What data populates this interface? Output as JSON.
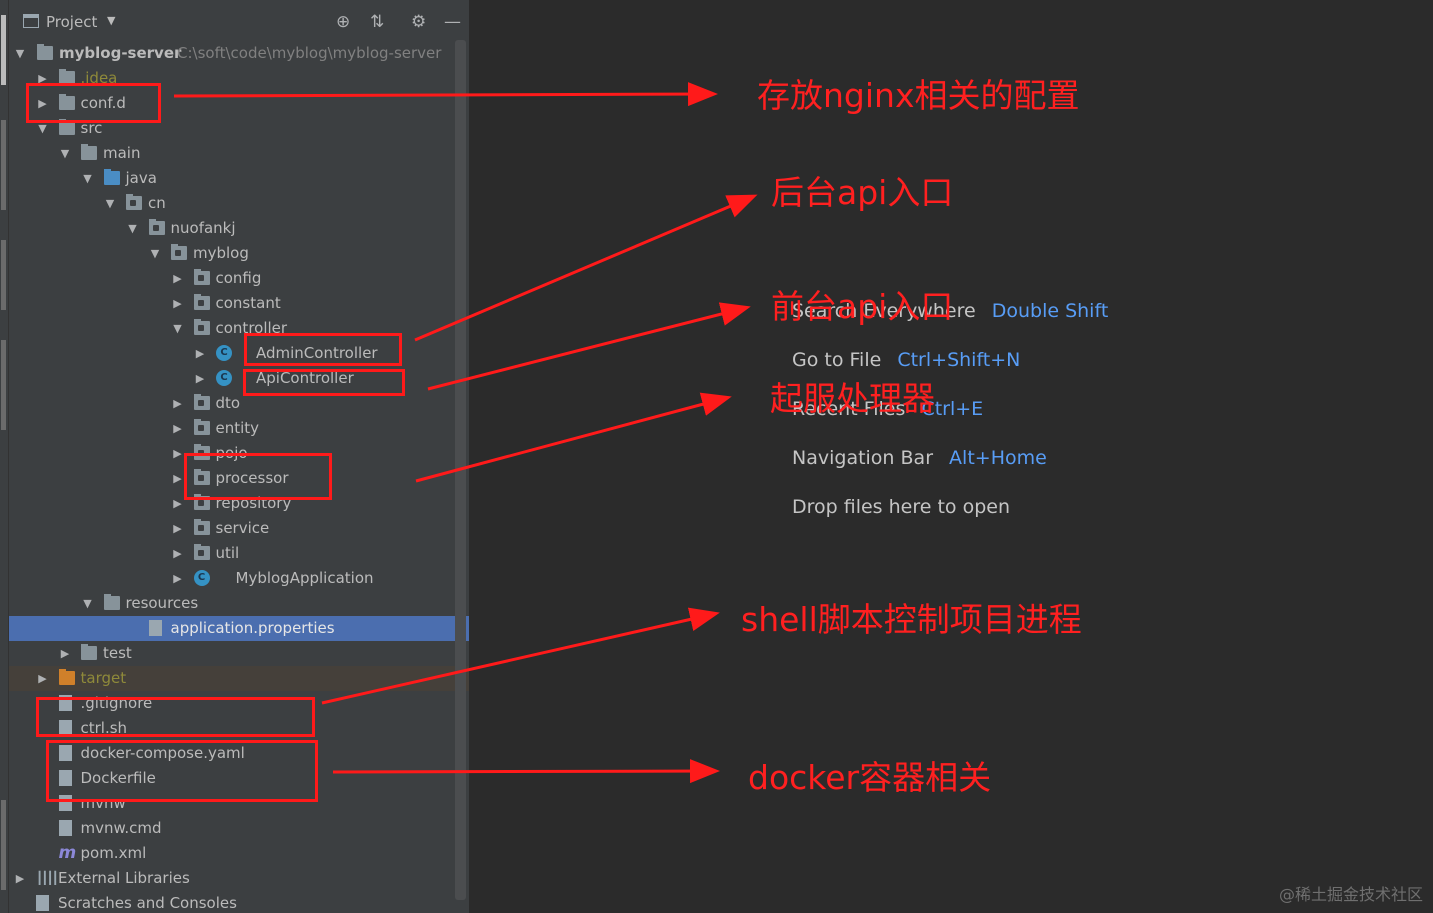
{
  "panel": {
    "title": "Project"
  },
  "root": {
    "name": "myblog-server",
    "path": "C:\\soft\\code\\myblog\\myblog-server"
  },
  "tree": [
    {
      "id": "idea",
      "label": ".idea",
      "style": "olive"
    },
    {
      "id": "confd",
      "label": "conf.d"
    },
    {
      "id": "src",
      "label": "src"
    },
    {
      "id": "main",
      "label": "main"
    },
    {
      "id": "java",
      "label": "java"
    },
    {
      "id": "cn",
      "label": "cn"
    },
    {
      "id": "nuofankj",
      "label": "nuofankj"
    },
    {
      "id": "myblog",
      "label": "myblog"
    },
    {
      "id": "config",
      "label": "config"
    },
    {
      "id": "constant",
      "label": "constant"
    },
    {
      "id": "controller",
      "label": "controller"
    },
    {
      "id": "admincontroller",
      "label": "AdminController"
    },
    {
      "id": "apicontroller",
      "label": "ApiController"
    },
    {
      "id": "dto",
      "label": "dto"
    },
    {
      "id": "entity",
      "label": "entity"
    },
    {
      "id": "pojo",
      "label": "pojo"
    },
    {
      "id": "processor",
      "label": "processor"
    },
    {
      "id": "repository",
      "label": "repository"
    },
    {
      "id": "service",
      "label": "service"
    },
    {
      "id": "util",
      "label": "util"
    },
    {
      "id": "myblogapplication",
      "label": "MyblogApplication"
    },
    {
      "id": "resources",
      "label": "resources"
    },
    {
      "id": "appprops",
      "label": "application.properties",
      "selected": true
    },
    {
      "id": "test",
      "label": "test"
    },
    {
      "id": "target",
      "label": "target",
      "style": "olive"
    },
    {
      "id": "gitignore",
      "label": ".gitignore"
    },
    {
      "id": "ctrlsh",
      "label": "ctrl.sh"
    },
    {
      "id": "dockercompose",
      "label": "docker-compose.yaml"
    },
    {
      "id": "dockerfile",
      "label": "Dockerfile"
    },
    {
      "id": "mvnw",
      "label": "mvnw"
    },
    {
      "id": "mvnwcmd",
      "label": "mvnw.cmd"
    },
    {
      "id": "pomxml",
      "label": "pom.xml"
    },
    {
      "id": "extlibs",
      "label": "External Libraries"
    },
    {
      "id": "scratches",
      "label": "Scratches and Consoles"
    }
  ],
  "hints": [
    {
      "text": "Search Everywhere",
      "shortcut": "Double Shift"
    },
    {
      "text": "Go to File",
      "shortcut": "Ctrl+Shift+N"
    },
    {
      "text": "Recent Files",
      "shortcut": "Ctrl+E"
    },
    {
      "text": "Navigation Bar",
      "shortcut": "Alt+Home"
    },
    {
      "text": "Drop files here to open",
      "shortcut": ""
    }
  ],
  "annotations": {
    "nginx": "存放nginx相关的配置",
    "admin_api": "后台api入口",
    "front_api": "前台api入口",
    "processor": "起服处理器",
    "shell": "shell脚本控制项目进程",
    "docker": "docker容器相关"
  },
  "watermark": "@稀土掘金技术社区",
  "colors": {
    "annotation": "#ff1a1a",
    "shortcut": "#589df6",
    "selection": "#4b6eaf"
  }
}
